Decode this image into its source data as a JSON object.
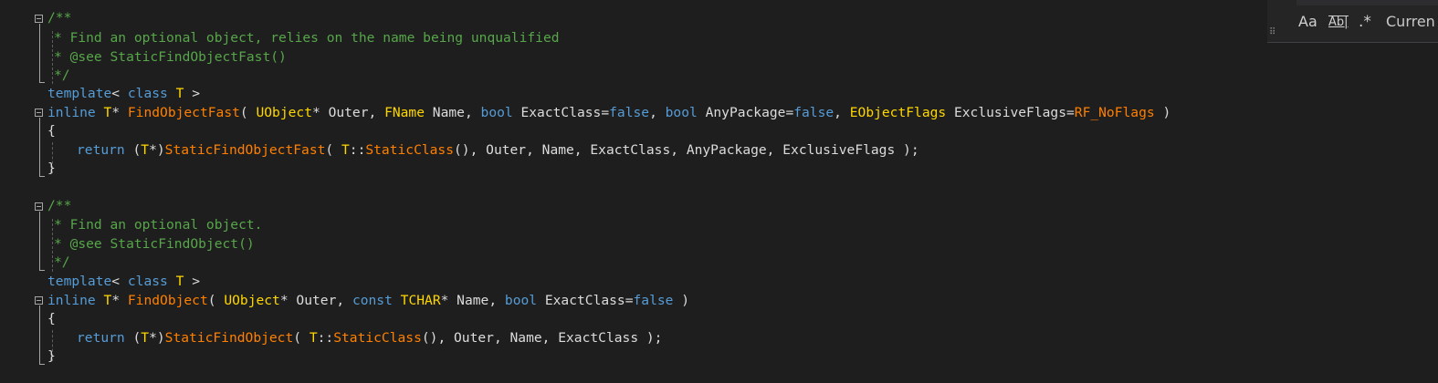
{
  "code": {
    "block1": {
      "comment_open": "/**",
      "comment_line1": "* Find an optional object, relies on the name being unqualified",
      "comment_line2": "* @see StaticFindObjectFast()",
      "comment_close": "*/",
      "template_kw": "template",
      "template_rest": "< ",
      "template_class_kw": "class",
      "template_T": "T",
      "template_end": " >",
      "sig_inline": "inline",
      "sig_T": "T",
      "sig_star": "* ",
      "sig_fn": "FindObjectFast",
      "sig_p1": "( ",
      "sig_uobject": "UObject",
      "sig_p2": "* Outer, ",
      "sig_fname": "FName",
      "sig_p3": " Name, ",
      "sig_bool1": "bool",
      "sig_p4": " ExactClass=",
      "sig_false1": "false",
      "sig_p5": ", ",
      "sig_bool2": "bool",
      "sig_p6": " AnyPackage=",
      "sig_false2": "false",
      "sig_p7": ", ",
      "sig_flags_type": "EObjectFlags",
      "sig_p8": " ExclusiveFlags=",
      "sig_rf": "RF_NoFlags",
      "sig_p9": " )",
      "brace_open": "{",
      "ret_kw": "return",
      "ret_p1": " (",
      "ret_T": "T",
      "ret_p2": "*)",
      "ret_fn": "StaticFindObjectFast",
      "ret_p3": "( ",
      "ret_T2": "T",
      "ret_p4": "::",
      "ret_static": "StaticClass",
      "ret_p5": "(), Outer, Name, ExactClass, AnyPackage, ExclusiveFlags );",
      "brace_close": "}"
    },
    "block2": {
      "comment_open": "/**",
      "comment_line1": "* Find an optional object.",
      "comment_line2": "* @see StaticFindObject()",
      "comment_close": "*/",
      "template_kw": "template",
      "template_rest": "< ",
      "template_class_kw": "class",
      "template_T": "T",
      "template_end": " >",
      "sig_inline": "inline",
      "sig_T": "T",
      "sig_star": "* ",
      "sig_fn": "FindObject",
      "sig_p1": "( ",
      "sig_uobject": "UObject",
      "sig_p2": "* Outer, ",
      "sig_const": "const",
      "sig_p3": " ",
      "sig_tchar": "TCHAR",
      "sig_p4": "* Name, ",
      "sig_bool1": "bool",
      "sig_p5": " ExactClass=",
      "sig_false1": "false",
      "sig_p6": " )",
      "brace_open": "{",
      "ret_kw": "return",
      "ret_p1": " (",
      "ret_T": "T",
      "ret_p2": "*)",
      "ret_fn": "StaticFindObject",
      "ret_p3": "( ",
      "ret_T2": "T",
      "ret_p4": "::",
      "ret_static": "StaticClass",
      "ret_p5": "(), Outer, Name, ExactClass );",
      "brace_close": "}"
    }
  },
  "find_widget": {
    "match_case_label": "Aa",
    "whole_word_label": "Ab|",
    "regex_label": ".*",
    "scope_label": "Curren",
    "grip_glyph": "⠿"
  },
  "colors": {
    "background": "#1e1e1e",
    "comment": "#57a64a",
    "keyword": "#569cd6",
    "class_name": "#ffd700",
    "function": "#ff8000",
    "macro": "#bd63c5"
  }
}
